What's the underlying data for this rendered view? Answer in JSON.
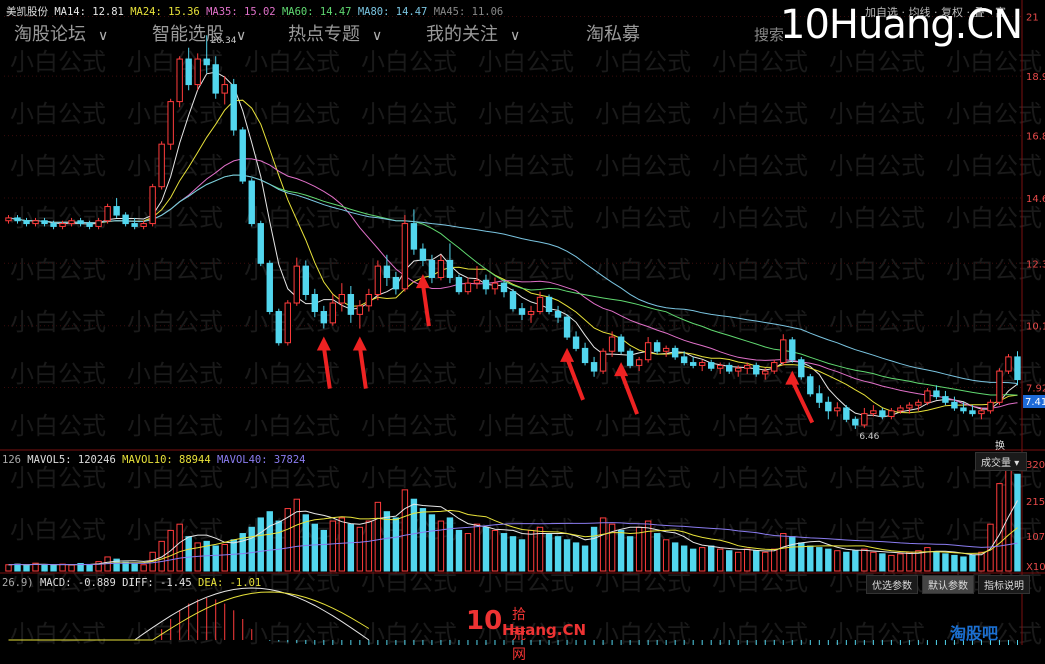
{
  "brand": "10Huang.CN",
  "nav": [
    {
      "label": "淘股论坛"
    },
    {
      "label": "智能选股"
    },
    {
      "label": "热点专题"
    },
    {
      "label": "我的关注"
    },
    {
      "label": "淘私募"
    }
  ],
  "search_label": "搜索",
  "top_right_items": "加自选 · 均线 · 复权 · 叠 · 富",
  "ma_legend": {
    "stock": "美凯股份",
    "ma14": "MA14: 12.81",
    "ma24": "MA24: 15.36",
    "ma35": "MA35: 15.02",
    "ma60": "MA60: 14.47",
    "ma80": "MA80: 14.47",
    "ma45": "MA45: 11.06"
  },
  "vol_legend": {
    "prefix": "126",
    "mavol5": "MAVOL5: 120246",
    "mavol10": "MAVOL10: 88944",
    "mavol40": "MAVOL40: 37824"
  },
  "macd_legend": {
    "prefix": "26.9)",
    "macd": "MACD: -0.889",
    "diff": "DIFF: -1.45",
    "dea": "DEA: -1.01"
  },
  "volume_panel_label": "成交量",
  "volume_panel_short": "换",
  "controls": {
    "optional_params": "优选参数",
    "default_params": "默认参数",
    "indicator_help": "指标说明"
  },
  "footer_logo": {
    "ten": "10",
    "cn_top": "拾荒网",
    "cn_bottom": "Huang.CN"
  },
  "corner_watermark": "淘股吧",
  "watermark_text": "小白公式",
  "colors": {
    "up": "#ff3c3c",
    "down": "#52d6ee",
    "bg": "#000000",
    "ma_white": "#e6e6e6",
    "ma_yellow": "#e8e23a",
    "ma_pink": "#e070c8",
    "ma_green": "#60d870",
    "ma_cyan": "#7ac4e0",
    "arrow": "#ee2222"
  },
  "chart_data": {
    "type": "candlestick",
    "price_axis_ticks": [
      "21",
      "18.9",
      "16.8",
      "14.6",
      "12.3",
      "10.1",
      "7.92"
    ],
    "current_price_label": "7.41",
    "high_label": "20.34",
    "low_label": "6.46",
    "volume_axis_ticks": [
      "320",
      "215",
      "107",
      "X10"
    ],
    "ylim": [
      6.0,
      21.3
    ],
    "candles_ohlc": [
      [
        13.8,
        14.0,
        13.7,
        13.9
      ],
      [
        13.9,
        14.0,
        13.7,
        13.8
      ],
      [
        13.8,
        13.9,
        13.6,
        13.7
      ],
      [
        13.7,
        13.9,
        13.6,
        13.8
      ],
      [
        13.8,
        13.9,
        13.6,
        13.7
      ],
      [
        13.7,
        13.8,
        13.5,
        13.6
      ],
      [
        13.6,
        13.8,
        13.5,
        13.7
      ],
      [
        13.7,
        13.9,
        13.6,
        13.8
      ],
      [
        13.8,
        13.9,
        13.6,
        13.7
      ],
      [
        13.7,
        13.8,
        13.5,
        13.6
      ],
      [
        13.6,
        13.9,
        13.5,
        13.8
      ],
      [
        13.8,
        14.4,
        13.7,
        14.3
      ],
      [
        14.3,
        14.6,
        13.9,
        14.0
      ],
      [
        14.0,
        14.1,
        13.6,
        13.7
      ],
      [
        13.7,
        13.9,
        13.5,
        13.6
      ],
      [
        13.6,
        13.8,
        13.5,
        13.7
      ],
      [
        13.7,
        15.1,
        13.6,
        15.0
      ],
      [
        15.0,
        16.6,
        14.9,
        16.5
      ],
      [
        16.5,
        18.1,
        16.3,
        18.0
      ],
      [
        18.0,
        19.6,
        17.8,
        19.5
      ],
      [
        19.5,
        19.9,
        18.4,
        18.6
      ],
      [
        18.6,
        19.7,
        18.4,
        19.5
      ],
      [
        19.5,
        20.34,
        19.0,
        19.3
      ],
      [
        19.3,
        19.6,
        18.1,
        18.3
      ],
      [
        18.3,
        18.9,
        17.9,
        18.6
      ],
      [
        18.6,
        18.8,
        16.8,
        17.0
      ],
      [
        17.0,
        17.1,
        15.1,
        15.2
      ],
      [
        15.2,
        15.3,
        13.6,
        13.7
      ],
      [
        13.7,
        13.8,
        12.2,
        12.3
      ],
      [
        12.3,
        12.4,
        10.5,
        10.6
      ],
      [
        10.6,
        10.7,
        9.4,
        9.5
      ],
      [
        9.5,
        11.0,
        9.4,
        10.9
      ],
      [
        10.9,
        12.5,
        10.8,
        12.2
      ],
      [
        12.2,
        12.4,
        11.0,
        11.2
      ],
      [
        11.2,
        11.4,
        10.4,
        10.6
      ],
      [
        10.6,
        10.8,
        10.0,
        10.2
      ],
      [
        10.2,
        11.2,
        10.1,
        10.9
      ],
      [
        10.9,
        11.6,
        10.6,
        11.2
      ],
      [
        11.2,
        11.5,
        10.2,
        10.5
      ],
      [
        10.5,
        11.0,
        10.0,
        10.8
      ],
      [
        10.8,
        11.4,
        10.6,
        11.2
      ],
      [
        11.2,
        12.4,
        11.0,
        12.2
      ],
      [
        12.2,
        12.6,
        11.5,
        11.8
      ],
      [
        11.8,
        12.0,
        11.2,
        11.4
      ],
      [
        11.4,
        14.0,
        11.3,
        13.7
      ],
      [
        13.7,
        14.2,
        12.6,
        12.8
      ],
      [
        12.8,
        13.0,
        12.2,
        12.4
      ],
      [
        12.4,
        12.6,
        11.6,
        11.8
      ],
      [
        11.8,
        12.6,
        11.7,
        12.4
      ],
      [
        12.4,
        13.0,
        11.6,
        11.8
      ],
      [
        11.8,
        11.9,
        11.2,
        11.3
      ],
      [
        11.3,
        11.8,
        11.2,
        11.6
      ],
      [
        11.6,
        12.2,
        11.4,
        11.7
      ],
      [
        11.7,
        11.9,
        11.2,
        11.4
      ],
      [
        11.4,
        11.8,
        11.2,
        11.6
      ],
      [
        11.6,
        11.7,
        11.1,
        11.3
      ],
      [
        11.3,
        11.4,
        10.6,
        10.7
      ],
      [
        10.7,
        10.9,
        10.3,
        10.5
      ],
      [
        10.5,
        10.8,
        10.2,
        10.6
      ],
      [
        10.6,
        11.3,
        10.5,
        11.1
      ],
      [
        11.1,
        11.2,
        10.5,
        10.6
      ],
      [
        10.6,
        10.8,
        10.2,
        10.4
      ],
      [
        10.4,
        10.5,
        9.6,
        9.7
      ],
      [
        9.7,
        9.9,
        9.2,
        9.3
      ],
      [
        9.3,
        9.5,
        8.7,
        8.8
      ],
      [
        8.8,
        9.0,
        8.3,
        8.5
      ],
      [
        8.5,
        9.3,
        8.4,
        9.2
      ],
      [
        9.2,
        9.9,
        9.0,
        9.7
      ],
      [
        9.7,
        9.8,
        9.1,
        9.2
      ],
      [
        9.2,
        9.3,
        8.6,
        8.7
      ],
      [
        8.7,
        9.0,
        8.5,
        8.9
      ],
      [
        8.9,
        9.7,
        8.8,
        9.5
      ],
      [
        9.5,
        9.6,
        9.1,
        9.2
      ],
      [
        9.2,
        9.4,
        9.0,
        9.3
      ],
      [
        9.3,
        9.4,
        8.9,
        9.0
      ],
      [
        9.0,
        9.2,
        8.7,
        8.8
      ],
      [
        8.8,
        9.0,
        8.6,
        8.7
      ],
      [
        8.7,
        8.9,
        8.5,
        8.8
      ],
      [
        8.8,
        8.9,
        8.5,
        8.6
      ],
      [
        8.6,
        8.8,
        8.4,
        8.7
      ],
      [
        8.7,
        8.8,
        8.4,
        8.5
      ],
      [
        8.5,
        8.7,
        8.3,
        8.6
      ],
      [
        8.6,
        8.8,
        8.4,
        8.7
      ],
      [
        8.7,
        8.8,
        8.3,
        8.4
      ],
      [
        8.4,
        8.6,
        8.2,
        8.5
      ],
      [
        8.5,
        8.9,
        8.4,
        8.8
      ],
      [
        8.8,
        9.8,
        8.7,
        9.6
      ],
      [
        9.6,
        9.7,
        8.8,
        8.9
      ],
      [
        8.9,
        9.0,
        8.2,
        8.3
      ],
      [
        8.3,
        8.4,
        7.6,
        7.7
      ],
      [
        7.7,
        8.0,
        7.2,
        7.4
      ],
      [
        7.4,
        7.6,
        6.8,
        7.1
      ],
      [
        7.1,
        7.4,
        6.9,
        7.2
      ],
      [
        7.2,
        7.3,
        6.7,
        6.8
      ],
      [
        6.8,
        6.9,
        6.46,
        6.6
      ],
      [
        6.6,
        7.2,
        6.5,
        7.0
      ],
      [
        7.0,
        7.3,
        6.9,
        7.1
      ],
      [
        7.1,
        7.2,
        6.8,
        6.9
      ],
      [
        6.9,
        7.2,
        6.8,
        7.1
      ],
      [
        7.1,
        7.3,
        7.0,
        7.2
      ],
      [
        7.2,
        7.4,
        7.0,
        7.3
      ],
      [
        7.3,
        7.5,
        7.1,
        7.4
      ],
      [
        7.4,
        7.9,
        7.3,
        7.8
      ],
      [
        7.8,
        8.0,
        7.5,
        7.6
      ],
      [
        7.6,
        7.8,
        7.3,
        7.4
      ],
      [
        7.4,
        7.6,
        7.1,
        7.2
      ],
      [
        7.2,
        7.4,
        7.0,
        7.1
      ],
      [
        7.1,
        7.3,
        6.9,
        7.0
      ],
      [
        7.0,
        7.2,
        6.8,
        7.1
      ],
      [
        7.1,
        7.5,
        7.0,
        7.4
      ],
      [
        7.4,
        8.6,
        7.3,
        8.5
      ],
      [
        8.5,
        9.1,
        8.4,
        9.0
      ],
      [
        9.0,
        9.2,
        8.0,
        8.2
      ]
    ],
    "volumes": [
      20,
      22,
      18,
      25,
      20,
      18,
      22,
      19,
      24,
      21,
      30,
      45,
      38,
      28,
      22,
      20,
      60,
      95,
      130,
      150,
      110,
      90,
      95,
      80,
      85,
      100,
      120,
      140,
      170,
      190,
      160,
      200,
      230,
      180,
      150,
      130,
      160,
      170,
      150,
      140,
      160,
      220,
      190,
      170,
      260,
      230,
      200,
      180,
      160,
      170,
      130,
      120,
      150,
      140,
      130,
      120,
      110,
      100,
      130,
      140,
      120,
      110,
      100,
      90,
      80,
      140,
      170,
      150,
      130,
      110,
      140,
      160,
      120,
      100,
      90,
      80,
      70,
      75,
      80,
      70,
      65,
      60,
      70,
      65,
      60,
      70,
      120,
      110,
      90,
      80,
      75,
      70,
      65,
      60,
      65,
      70,
      60,
      55,
      50,
      55,
      60,
      65,
      75,
      60,
      55,
      50,
      45,
      50,
      60,
      150,
      280,
      330,
      310
    ],
    "annotations": [
      "red arrows marking pullback buy points"
    ]
  }
}
